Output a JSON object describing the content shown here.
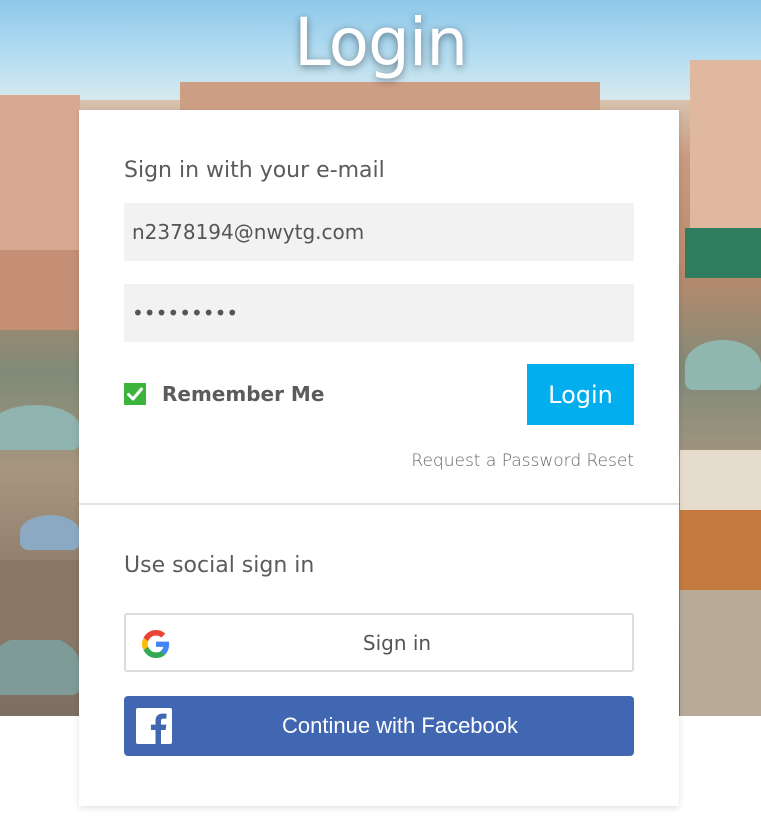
{
  "page": {
    "title": "Login"
  },
  "email_section": {
    "heading": "Sign in with your e-mail",
    "email_value": "n2378194@nwytg.com",
    "password_value": "•••••••••",
    "remember_label": "Remember Me",
    "remember_checked": true,
    "login_label": "Login",
    "reset_link": "Request a Password Reset"
  },
  "social_section": {
    "heading": "Use social sign in",
    "google_label": "Sign in",
    "facebook_label": "Continue with Facebook"
  },
  "colors": {
    "accent": "#03aeef",
    "facebook": "#4267b2",
    "checkbox": "#3cb43c"
  }
}
